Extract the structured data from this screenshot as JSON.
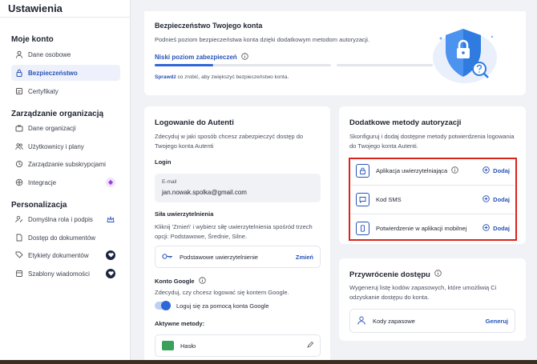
{
  "app": {
    "title": "Ustawienia"
  },
  "sidebar": {
    "sections": [
      {
        "title": "Moje konto",
        "items": [
          {
            "label": "Dane osobowe",
            "icon": "user-icon"
          },
          {
            "label": "Bezpieczeństwo",
            "icon": "lock-icon",
            "active": true
          },
          {
            "label": "Certyfikaty",
            "icon": "certificate-icon"
          }
        ]
      },
      {
        "title": "Zarządzanie organizacją",
        "items": [
          {
            "label": "Dane organizacji",
            "icon": "briefcase-icon"
          },
          {
            "label": "Użytkownicy i plany",
            "icon": "users-icon"
          },
          {
            "label": "Zarządzanie subskrypcjami",
            "icon": "subscription-icon"
          },
          {
            "label": "Integracje",
            "icon": "integration-icon"
          }
        ]
      },
      {
        "title": "Personalizacja",
        "items": [
          {
            "label": "Domyślna rola i podpis",
            "icon": "role-icon"
          },
          {
            "label": "Dostęp do dokumentów",
            "icon": "document-icon"
          },
          {
            "label": "Etykiety dokumentów",
            "icon": "tag-icon"
          },
          {
            "label": "Szablony wiadomości",
            "icon": "template-icon"
          }
        ]
      }
    ]
  },
  "security": {
    "title": "Bezpieczeństwo Twojego konta",
    "description": "Podnieś poziom bezpieczeństwa konta dzięki dodatkowym metodom autoryzacji.",
    "level_label": "Niski poziom zabezpieczeń",
    "level_progress": 0.33,
    "check_link": "Sprawdź",
    "check_text": " co zrobić, aby zwiększyć bezpieczeństwo konta."
  },
  "login": {
    "title": "Logowanie do Autenti",
    "description": "Zdecyduj w jaki sposób chcesz zabezpieczyć dostęp do Twojego konta Autenti",
    "login_label": "Login",
    "email_caption": "E-mail",
    "email_value": "jan.nowak.spolka@gmail.com",
    "strength_title": "Siła uwierzytelnienia",
    "strength_desc": "Kliknij 'Zmień' i wybierz siłę uwierzytelnienia spośród trzech opcji: Podstawowe, Średnie, Silne.",
    "strength_value": "Podstawowe uwierzytelnienie",
    "change_label": "Zmień",
    "google_title": "Konto Google",
    "google_desc": "Zdecyduj, czy chcesz logować się kontem Google.",
    "google_toggle_label": "Loguj się za pomocą konta Google",
    "google_toggle_on": true,
    "active_methods_title": "Aktywne metody:",
    "password_label": "Hasło"
  },
  "extra_methods": {
    "title": "Dodatkowe metody autoryzacji",
    "description": "Skonfiguruj i dodaj dostępne metody potwierdzenia logowania do Twojego konta Autenti.",
    "add_label": "Dodaj",
    "methods": [
      {
        "label": "Aplikacja uwierzytelniająca",
        "icon": "authenticator-app-icon"
      },
      {
        "label": "Kod SMS",
        "icon": "sms-icon"
      },
      {
        "label": "Potwierdzenie w aplikacji mobilnej",
        "icon": "mobile-phone-icon"
      }
    ]
  },
  "recovery": {
    "title": "Przywrócenie dostępu",
    "description": "Wygeneruj listę kodów zapasowych, które umożliwią Ci odzyskanie dostępu do konta.",
    "codes_label": "Kody zapasowe",
    "generate_label": "Generuj"
  },
  "colors": {
    "accent": "#2753b8",
    "highlight": "#d9241c",
    "success": "#3aa15a"
  }
}
